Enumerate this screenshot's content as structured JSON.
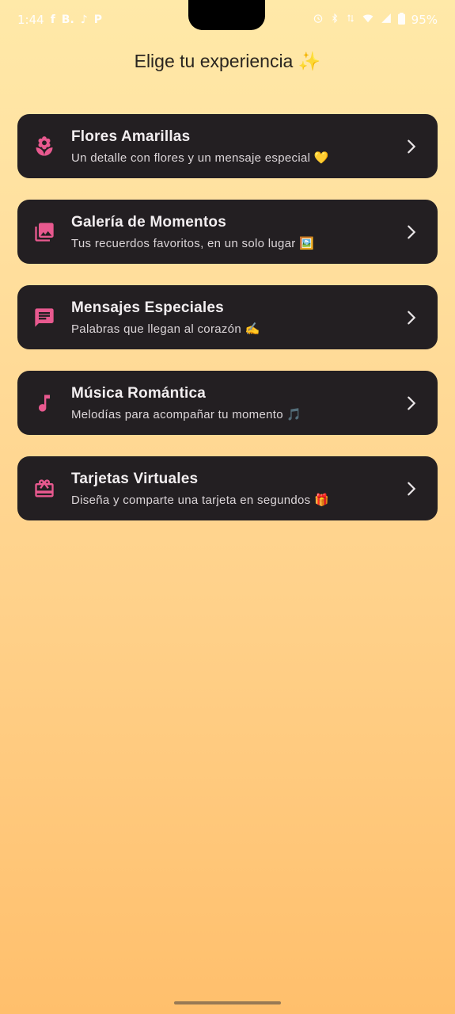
{
  "status_bar": {
    "time": "1:44",
    "left_icons": [
      "facebook-icon",
      "b-app-icon",
      "tiktok-icon",
      "p-app-icon"
    ],
    "left_glyphs": [
      "f",
      "B.",
      "♪",
      "P"
    ],
    "right_icons": [
      "alarm-icon",
      "bluetooth-icon",
      "data-icon",
      "wifi-icon",
      "signal-icon",
      "battery-icon"
    ],
    "battery": "95%"
  },
  "header": {
    "title": "Elige tu experiencia ✨"
  },
  "menu": {
    "items": [
      {
        "icon": "flower-icon",
        "title": "Flores Amarillas",
        "subtitle": "Un detalle con flores y un mensaje especial 💛"
      },
      {
        "icon": "photo-library-icon",
        "title": "Galería de Momentos",
        "subtitle": "Tus recuerdos favoritos, en un solo lugar 🖼️"
      },
      {
        "icon": "message-icon",
        "title": "Mensajes Especiales",
        "subtitle": "Palabras que llegan al corazón ✍️"
      },
      {
        "icon": "music-note-icon",
        "title": "Música Romántica",
        "subtitle": "Melodías para acompañar tu momento 🎵"
      },
      {
        "icon": "gift-card-icon",
        "title": "Tarjetas Virtuales",
        "subtitle": "Diseña y comparte una tarjeta en segundos 🎁"
      }
    ]
  },
  "colors": {
    "card_bg": "#231f22",
    "accent": "#e8598f",
    "gradient_top": "#ffe9a8",
    "gradient_bottom": "#ffbf6c"
  }
}
